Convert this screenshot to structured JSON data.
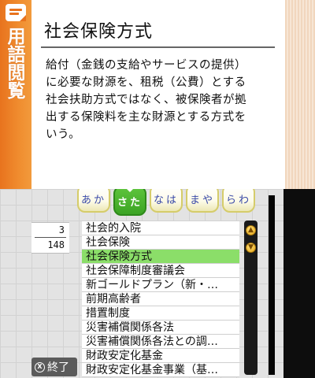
{
  "top_screen": {
    "side_tab_label": "用語閲覧",
    "term_title": "社会保険方式",
    "term_description": "給付（金銭の支給やサービスの提供）\nに必要な財源を、租税（公費）とする\n社会扶助方式ではなく、被保険者が拠\n出する保険料を主な財源とする方式を\nいう。"
  },
  "kana_tabs": [
    {
      "label": "あか",
      "active": false
    },
    {
      "label": "さた",
      "active": true
    },
    {
      "label": "なは",
      "active": false
    },
    {
      "label": "まや",
      "active": false
    },
    {
      "label": "らわ",
      "active": false
    }
  ],
  "page_counter": {
    "current": "3",
    "total": "148"
  },
  "term_list": {
    "selected_index": 2,
    "items": [
      "社会的入院",
      "社会保険",
      "社会保険方式",
      "社会保障制度審議会",
      "新ゴールドプラン（新・…",
      "前期高齢者",
      "措置制度",
      "災害補償関係各法",
      "災害補償関係各法との調…",
      "財政安定化基金",
      "財政安定化基金事業（基…"
    ]
  },
  "scrollbar": {
    "up_icon": "up-arrow-icon",
    "down_icon": "down-arrow-icon"
  },
  "end_button": {
    "icon_glyph": "X",
    "label": "終了"
  },
  "colors": {
    "side_tab": "#e8731e",
    "selected_row": "#8bde69",
    "active_tab": "#4db430",
    "tab_border": "#d5cc6a"
  }
}
